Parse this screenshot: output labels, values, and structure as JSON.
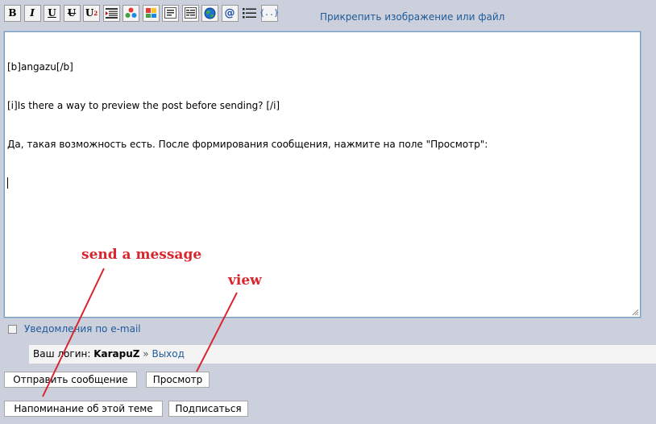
{
  "toolbar": {
    "buttons": [
      {
        "name": "bold-button",
        "label": "B"
      },
      {
        "name": "italic-button",
        "label": "I"
      },
      {
        "name": "underline-button",
        "label": "U"
      },
      {
        "name": "strikethrough-button",
        "label": "U"
      },
      {
        "name": "superscript-button",
        "label": "U"
      },
      {
        "name": "align-button",
        "icon": "align-lines-icon"
      },
      {
        "name": "color-button",
        "icon": "color-palette-icon"
      },
      {
        "name": "highlight-button",
        "icon": "color-swatch-icon"
      },
      {
        "name": "quote-button",
        "icon": "quote-block-icon"
      },
      {
        "name": "code-button",
        "icon": "code-block-icon"
      },
      {
        "name": "insert-link-button",
        "icon": "globe-icon"
      },
      {
        "name": "email-button",
        "icon": "at-sign-icon"
      },
      {
        "name": "list-button",
        "icon": "bullet-list-icon"
      },
      {
        "name": "spoiler-button",
        "icon": "braces-icon"
      }
    ],
    "superscript_mark": "2",
    "attach_label": "Прикрепить изображение или файл"
  },
  "editor": {
    "lines": [
      "[b]angazu[/b]",
      "[i]Is there a way to preview the post before sending? [/i]",
      "Да, такая возможность есть. После формирования сообщения, нажмите на поле \"Просмотр\":"
    ]
  },
  "options": {
    "email_notify_label": "Уведомления по e-mail",
    "email_notify_checked": false
  },
  "login": {
    "prefix": "Ваш логин:",
    "username": "KarapuZ",
    "separator": "»",
    "logout_label": "Выход"
  },
  "buttons": {
    "send_label": "Отправить сообщение",
    "preview_label": "Просмотр",
    "reminder_label": "Напоминание об этой теме",
    "subscribe_label": "Подписаться"
  },
  "annotations": {
    "send_note": "send a message",
    "view_note": "view",
    "color": "#d8262f"
  },
  "colors": {
    "background": "#cbd0dc",
    "link": "#1f5a99",
    "editor_border": "#7f9db9"
  }
}
